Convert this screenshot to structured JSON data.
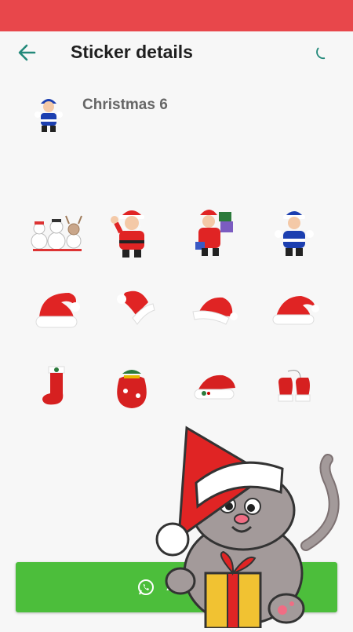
{
  "app_bar": {
    "title": "Sticker details"
  },
  "pack": {
    "name": "Christmas 6"
  },
  "stickers": [
    {
      "icon": "snowmen-reindeer-sticker"
    },
    {
      "icon": "santa-waving-sticker"
    },
    {
      "icon": "santa-gifts-sticker"
    },
    {
      "icon": "blue-santa-sticker"
    },
    {
      "icon": "santa-hat-sticker"
    },
    {
      "icon": "santa-hat-tilted-sticker"
    },
    {
      "icon": "santa-hat-sticker"
    },
    {
      "icon": "santa-hat-sticker"
    },
    {
      "icon": "christmas-stocking-sticker"
    },
    {
      "icon": "gift-sack-sticker"
    },
    {
      "icon": "santa-hat-holly-sticker"
    },
    {
      "icon": "mittens-sticker"
    }
  ],
  "add_button": {
    "label": "ADD TO"
  },
  "colors": {
    "status_bar": "#e8474b",
    "accent": "#23897a",
    "button": "#4cbe3b"
  }
}
